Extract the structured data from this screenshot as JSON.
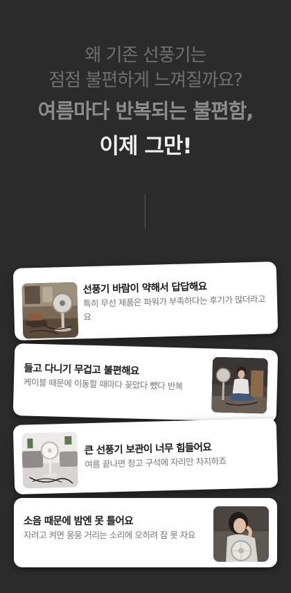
{
  "headline": {
    "line1": "왜 기존 선풍기는",
    "line2": "점점 불편하게 느껴질까요?",
    "line3": "여름마다 반복되는 불편함,",
    "line4": "이제 그만!"
  },
  "colors": {
    "background": "#2b2b2b",
    "card": "#ffffff",
    "muted_headline": "#6f6f6f",
    "emphasis_headline": "#f2f2f2"
  },
  "cards": [
    {
      "title": "선풍기 바람이 약해서 답답해요",
      "desc": "특히 무선 제품은 파워가 부족하다는 후기가 많더라고요",
      "image": "messy-room-with-fan-photo"
    },
    {
      "title": "들고 다니기 무겁고 불편해요",
      "desc": "케이블 때문에 이동할 때마다 꽂았다 뺐다 반복",
      "image": "woman-sitting-floor-fan-photo"
    },
    {
      "title": "큰 선풍기 보관이 너무 힘들어요",
      "desc": "여름 끝나면 창고 구석에 자리만 차지하죠",
      "image": "living-room-fan-cables-photo"
    },
    {
      "title": "소음 때문에 밤엔 못 틀어요",
      "desc": "자려고 켜면 웅웅 거리는 소리에 오히려 잠 못 자요",
      "image": "tired-woman-fan-photo"
    }
  ]
}
